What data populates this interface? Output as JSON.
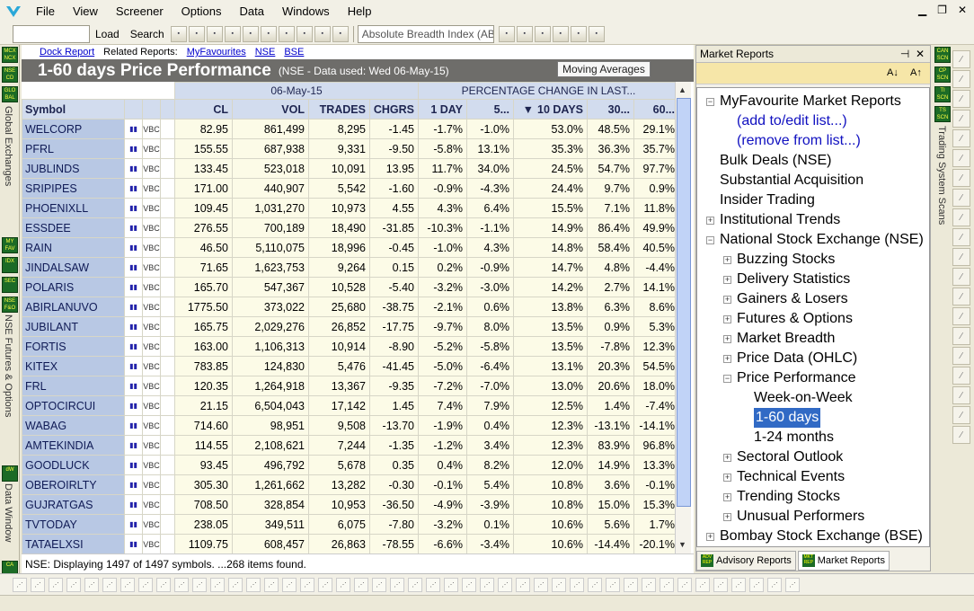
{
  "menu": [
    "File",
    "View",
    "Screener",
    "Options",
    "Data",
    "Windows",
    "Help"
  ],
  "toolbar": {
    "load": "Load",
    "search": "Search",
    "indicator_select": "Absolute Breadth Index (ABI"
  },
  "toolbar_icons": [
    "cursor-icon",
    "save-icon",
    "print-icon",
    "preview-icon",
    "dw-icon",
    "tag-icon",
    "chart-icon",
    "wizard-icon",
    "globe-icon",
    "monitor-icon",
    "bars-icon",
    "fibo-icon",
    "52w-icon",
    "hilo-icon",
    "ma-icon",
    "compare-icon"
  ],
  "left_strip": {
    "btn1": "MCX NCX",
    "btn2": "NSE CD",
    "btn3": "GLO BAL",
    "label1": "Global Exchanges",
    "btn4": "MY FAV",
    "btn5": "IDX",
    "btn6": "SEC",
    "btn7": "NSE F&O",
    "label2": "NSE Futures & Options",
    "btn8": "dW",
    "label3": "Data Window",
    "btn9": "CA"
  },
  "right_strip": {
    "btn1": "CAN SCN",
    "btn2": "CP SCN",
    "btn3": "TI SCN",
    "btn4": "TS SCN",
    "label": "Trading System Scans"
  },
  "report": {
    "related_links": {
      "dock": "Dock Report",
      "prefix": "Related Reports:",
      "myfav": "MyFavourites",
      "nse": "NSE",
      "bse": "BSE"
    },
    "title": "1-60 days Price Performance",
    "subtitle": "(NSE - Data used: Wed 06-May-15)",
    "moving_avg_button": "Moving Averages",
    "group_date": "06-May-15",
    "group_pct": "PERCENTAGE CHANGE IN LAST...",
    "headers": [
      "Symbol",
      "CL",
      "VOL",
      "TRADES",
      "CHGRS",
      "1 DAY",
      "5...",
      "10 DAYS",
      "30...",
      "60..."
    ],
    "sort_indicator": "▼",
    "icon_label": "VBC",
    "rows": [
      [
        "WELCORP",
        "82.95",
        "861,499",
        "8,295",
        "-1.45",
        "-1.7%",
        "-1.0%",
        "53.0%",
        "48.5%",
        "29.1%"
      ],
      [
        "PFRL",
        "155.55",
        "687,938",
        "9,331",
        "-9.50",
        "-5.8%",
        "13.1%",
        "35.3%",
        "36.3%",
        "35.7%"
      ],
      [
        "JUBLINDS",
        "133.45",
        "523,018",
        "10,091",
        "13.95",
        "11.7%",
        "34.0%",
        "24.5%",
        "54.7%",
        "97.7%"
      ],
      [
        "SRIPIPES",
        "171.00",
        "440,907",
        "5,542",
        "-1.60",
        "-0.9%",
        "-4.3%",
        "24.4%",
        "9.7%",
        "0.9%"
      ],
      [
        "PHOENIXLL",
        "109.45",
        "1,031,270",
        "10,973",
        "4.55",
        "4.3%",
        "6.4%",
        "15.5%",
        "7.1%",
        "11.8%"
      ],
      [
        "ESSDEE",
        "276.55",
        "700,189",
        "18,490",
        "-31.85",
        "-10.3%",
        "-1.1%",
        "14.9%",
        "86.4%",
        "49.9%"
      ],
      [
        "RAIN",
        "46.50",
        "5,110,075",
        "18,996",
        "-0.45",
        "-1.0%",
        "4.3%",
        "14.8%",
        "58.4%",
        "40.5%"
      ],
      [
        "JINDALSAW",
        "71.65",
        "1,623,753",
        "9,264",
        "0.15",
        "0.2%",
        "-0.9%",
        "14.7%",
        "4.8%",
        "-4.4%"
      ],
      [
        "POLARIS",
        "165.70",
        "547,367",
        "10,528",
        "-5.40",
        "-3.2%",
        "-3.0%",
        "14.2%",
        "2.7%",
        "14.1%"
      ],
      [
        "ABIRLANUVO",
        "1775.50",
        "373,022",
        "25,680",
        "-38.75",
        "-2.1%",
        "0.6%",
        "13.8%",
        "6.3%",
        "8.6%"
      ],
      [
        "JUBILANT",
        "165.75",
        "2,029,276",
        "26,852",
        "-17.75",
        "-9.7%",
        "8.0%",
        "13.5%",
        "0.9%",
        "5.3%"
      ],
      [
        "FORTIS",
        "163.00",
        "1,106,313",
        "10,914",
        "-8.90",
        "-5.2%",
        "-5.8%",
        "13.5%",
        "-7.8%",
        "12.3%"
      ],
      [
        "KITEX",
        "783.85",
        "124,830",
        "5,476",
        "-41.45",
        "-5.0%",
        "-6.4%",
        "13.1%",
        "20.3%",
        "54.5%"
      ],
      [
        "FRL",
        "120.35",
        "1,264,918",
        "13,367",
        "-9.35",
        "-7.2%",
        "-7.0%",
        "13.0%",
        "20.6%",
        "18.0%"
      ],
      [
        "OPTOCIRCUI",
        "21.15",
        "6,504,043",
        "17,142",
        "1.45",
        "7.4%",
        "7.9%",
        "12.5%",
        "1.4%",
        "-7.4%"
      ],
      [
        "WABAG",
        "714.60",
        "98,951",
        "9,508",
        "-13.70",
        "-1.9%",
        "0.4%",
        "12.3%",
        "-13.1%",
        "-14.1%"
      ],
      [
        "AMTEKINDIA",
        "114.55",
        "2,108,621",
        "7,244",
        "-1.35",
        "-1.2%",
        "3.4%",
        "12.3%",
        "83.9%",
        "96.8%"
      ],
      [
        "GOODLUCK",
        "93.45",
        "496,792",
        "5,678",
        "0.35",
        "0.4%",
        "8.2%",
        "12.0%",
        "14.9%",
        "13.3%"
      ],
      [
        "OBEROIRLTY",
        "305.30",
        "1,261,662",
        "13,282",
        "-0.30",
        "-0.1%",
        "5.4%",
        "10.8%",
        "3.6%",
        "-0.1%"
      ],
      [
        "GUJRATGAS",
        "708.50",
        "328,854",
        "10,953",
        "-36.50",
        "-4.9%",
        "-3.9%",
        "10.8%",
        "15.0%",
        "15.3%"
      ],
      [
        "TVTODAY",
        "238.05",
        "349,511",
        "6,075",
        "-7.80",
        "-3.2%",
        "0.1%",
        "10.6%",
        "5.6%",
        "1.7%"
      ],
      [
        "TATAELXSI",
        "1109.75",
        "608,457",
        "26,863",
        "-78.55",
        "-6.6%",
        "-3.4%",
        "10.6%",
        "-14.4%",
        "-20.1%"
      ]
    ],
    "status": "NSE: Displaying 1497 of 1497 symbols. ...268 items found."
  },
  "panel": {
    "title": "Market Reports",
    "sort_az": "A↓",
    "sort_za": "A↑",
    "tree": [
      {
        "label": "MyFavourite Market Reports",
        "level": 0,
        "exp": "−"
      },
      {
        "label": "(add to/edit list...)",
        "level": 1,
        "exp": "",
        "link": true
      },
      {
        "label": "(remove from list...)",
        "level": 1,
        "exp": "",
        "link": true
      },
      {
        "label": "Bulk Deals (NSE)",
        "level": 0,
        "exp": ""
      },
      {
        "label": "Substantial Acquisition",
        "level": 0,
        "exp": ""
      },
      {
        "label": "Insider Trading",
        "level": 0,
        "exp": ""
      },
      {
        "label": "Institutional Trends",
        "level": 0,
        "exp": "+"
      },
      {
        "label": "National Stock Exchange (NSE)",
        "level": 0,
        "exp": "−"
      },
      {
        "label": "Buzzing Stocks",
        "level": 1,
        "exp": "+"
      },
      {
        "label": "Delivery Statistics",
        "level": 1,
        "exp": "+"
      },
      {
        "label": "Gainers & Losers",
        "level": 1,
        "exp": "+"
      },
      {
        "label": "Futures & Options",
        "level": 1,
        "exp": "+"
      },
      {
        "label": "Market Breadth",
        "level": 1,
        "exp": "+"
      },
      {
        "label": "Price Data (OHLC)",
        "level": 1,
        "exp": "+"
      },
      {
        "label": "Price Performance",
        "level": 1,
        "exp": "−"
      },
      {
        "label": "Week-on-Week",
        "level": 2,
        "exp": ""
      },
      {
        "label": "1-60 days",
        "level": 2,
        "exp": "",
        "selected": true
      },
      {
        "label": "1-24 months",
        "level": 2,
        "exp": ""
      },
      {
        "label": "Sectoral Outlook",
        "level": 1,
        "exp": "+"
      },
      {
        "label": "Technical Events",
        "level": 1,
        "exp": "+"
      },
      {
        "label": "Trending Stocks",
        "level": 1,
        "exp": "+"
      },
      {
        "label": "Unusual Performers",
        "level": 1,
        "exp": "+"
      },
      {
        "label": "Bombay Stock Exchange (BSE)",
        "level": 0,
        "exp": "+"
      }
    ],
    "tabs": [
      {
        "icon": "ADV REP",
        "label": "Advisory Reports"
      },
      {
        "icon": "MKT REP",
        "label": "Market Reports"
      }
    ]
  },
  "colors": {
    "title_bg": "#6e6d6a",
    "symbol_bg": "#b8c8e4",
    "cell_bg": "#fcfbe7",
    "selection": "#316ac5",
    "sortbar": "#f6e6a8"
  }
}
